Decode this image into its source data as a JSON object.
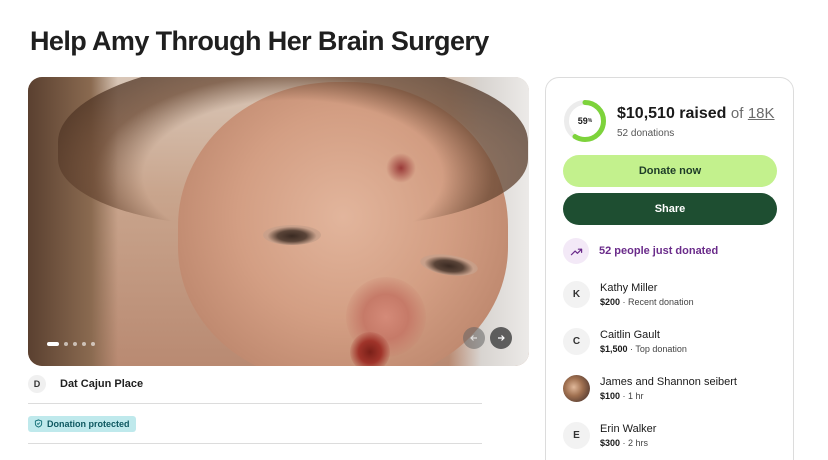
{
  "page": {
    "title": "Help Amy Through Her Brain Surgery"
  },
  "gallery": {
    "slide_count": 5,
    "active_slide": 1,
    "prev_icon": "arrow-left-icon",
    "next_icon": "arrow-right-icon"
  },
  "organizer": {
    "initial": "D",
    "name": "Dat Cajun Place"
  },
  "badge": {
    "label": "Donation protected",
    "icon": "shield-icon"
  },
  "progress": {
    "percent": 59,
    "percent_label": "59",
    "percent_suffix": "%",
    "raised": "$10,510 raised",
    "of": "of",
    "goal": "18K",
    "donations": "52 donations"
  },
  "buttons": {
    "donate": "Donate now",
    "share": "Share"
  },
  "trend": {
    "text": "52 people just donated",
    "icon": "trending-up-icon"
  },
  "donors": [
    {
      "initial": "K",
      "name": "Kathy Miller",
      "amount": "$200",
      "note": " · Recent donation"
    },
    {
      "initial": "C",
      "name": "Caitlin Gault",
      "amount": "$1,500",
      "note": " · Top donation"
    },
    {
      "initial": "",
      "name": "James and Shannon seibert",
      "amount": "$100",
      "note": " · 1 hr"
    },
    {
      "initial": "E",
      "name": "Erin Walker",
      "amount": "$300",
      "note": " · 2 hrs"
    }
  ],
  "colors": {
    "accent_green": "#c3f18d",
    "dark_green": "#1e4e31",
    "ring_green": "#7dd33b",
    "purple": "#6a2b8a"
  }
}
